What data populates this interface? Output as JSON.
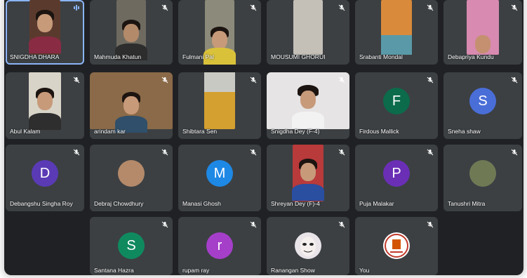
{
  "participants": [
    {
      "name": "SNIGDHA DHARA",
      "avatar_type": "video",
      "mic": "speaking"
    },
    {
      "name": "Mahmuda Khatun",
      "avatar_type": "video",
      "mic": "muted"
    },
    {
      "name": "Fulmani Pal",
      "avatar_type": "video",
      "mic": "muted"
    },
    {
      "name": "MOUSUMI GHORUI",
      "avatar_type": "video",
      "mic": "muted"
    },
    {
      "name": "Srabanti Mondal",
      "avatar_type": "video",
      "mic": "muted"
    },
    {
      "name": "Debapriya Kundu",
      "avatar_type": "video",
      "mic": "muted"
    },
    {
      "name": "Abul Kalam",
      "avatar_type": "video",
      "mic": "muted"
    },
    {
      "name": "arindam kar",
      "avatar_type": "video",
      "mic": "muted"
    },
    {
      "name": "Shibtara Sen",
      "avatar_type": "video",
      "mic": "muted"
    },
    {
      "name": "Snigdha Dey (F-4)",
      "avatar_type": "video",
      "mic": "muted"
    },
    {
      "name": "Firdous Mallick",
      "avatar_type": "letter",
      "letter": "F",
      "color": "#0b6b4a",
      "mic": "muted"
    },
    {
      "name": "Sneha shaw",
      "avatar_type": "letter",
      "letter": "S",
      "color": "#4a6ed8",
      "mic": "muted"
    },
    {
      "name": "Debangshu Singha Roy",
      "avatar_type": "letter",
      "letter": "D",
      "color": "#5a3bb5",
      "mic": "muted"
    },
    {
      "name": "Debraj Chowdhury",
      "avatar_type": "image",
      "mic": "muted"
    },
    {
      "name": "Manasi Ghosh",
      "avatar_type": "letter",
      "letter": "M",
      "color": "#1e88e5",
      "mic": "muted"
    },
    {
      "name": "Shreyan Dey (F)-4",
      "avatar_type": "video",
      "mic": "muted"
    },
    {
      "name": "Puja Malakar",
      "avatar_type": "letter",
      "letter": "P",
      "color": "#6a2fb5",
      "mic": "muted"
    },
    {
      "name": "Tanushri Mitra",
      "avatar_type": "image",
      "mic": "muted"
    },
    {
      "name": "Santana Hazra",
      "avatar_type": "letter",
      "letter": "S",
      "color": "#0f8a5f",
      "mic": "muted"
    },
    {
      "name": "rupam ray",
      "avatar_type": "letter",
      "letter": "r",
      "color": "#a53fc9",
      "mic": "muted"
    },
    {
      "name": "Ranangan Show",
      "avatar_type": "image",
      "mic": "muted"
    },
    {
      "name": "You",
      "avatar_type": "image",
      "mic": "muted"
    }
  ],
  "colors": {
    "background": "#202124",
    "tile": "#3c4043",
    "speaking_border": "#8ab4f8",
    "speaking_icon": "#8ab4f8"
  }
}
